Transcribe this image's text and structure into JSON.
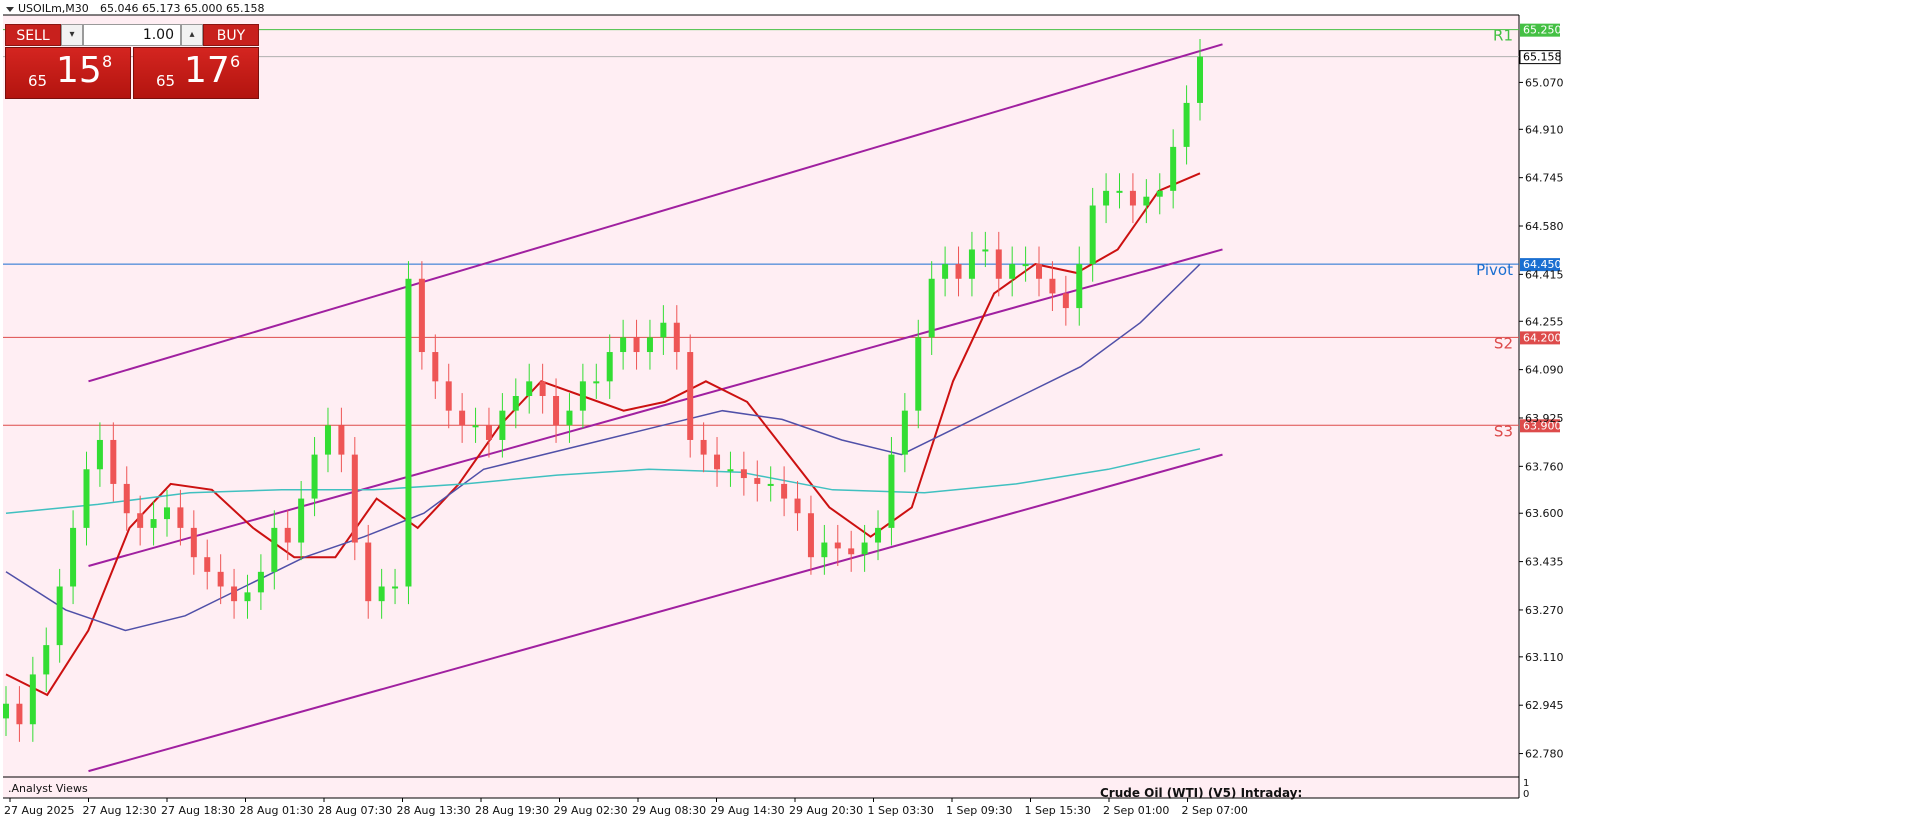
{
  "header": {
    "symbol_label": "USOILm,M30",
    "ohlc_text": "65.046 65.173 65.000 65.158",
    "menu_icon": "triangle-down-icon"
  },
  "trade_panel": {
    "sell_label": "SELL",
    "buy_label": "BUY",
    "lot_value": "1.00",
    "bid": {
      "prefix": "65",
      "big": "15",
      "sup": "8"
    },
    "ask": {
      "prefix": "65",
      "big": "17",
      "sup": "6"
    },
    "accent": "#c8201d"
  },
  "levels": [
    {
      "id": "r1",
      "name": "R1",
      "price": 65.25,
      "price_label": "65.250",
      "color": "#44c044"
    },
    {
      "id": "pivot",
      "name": "Pivot",
      "price": 64.45,
      "price_label": "64.450",
      "color": "#1a6fd1"
    },
    {
      "id": "s2",
      "name": "S2",
      "price": 64.2,
      "price_label": "64.200",
      "color": "#dd4b4b"
    },
    {
      "id": "s3",
      "name": "S3",
      "price": 63.9,
      "price_label": "63.900",
      "color": "#dd4b4b"
    }
  ],
  "current_price": {
    "price": 65.158,
    "label": "65.158"
  },
  "price_axis": {
    "min": 62.7,
    "max": 65.3,
    "ticks": [
      "65.070",
      "64.910",
      "64.745",
      "64.580",
      "64.415",
      "64.255",
      "64.090",
      "63.925",
      "63.760",
      "63.600",
      "63.435",
      "63.270",
      "63.110",
      "62.945",
      "62.780"
    ]
  },
  "time_axis": {
    "labels": [
      "27 Aug 2025",
      "27 Aug 12:30",
      "27 Aug 18:30",
      "28 Aug 01:30",
      "28 Aug 07:30",
      "28 Aug 13:30",
      "28 Aug 19:30",
      "29 Aug 02:30",
      "29 Aug 08:30",
      "29 Aug 14:30",
      "29 Aug 20:30",
      "1 Sep 03:30",
      "1 Sep 09:30",
      "1 Sep 15:30",
      "2 Sep 01:00",
      "2 Sep 07:00"
    ]
  },
  "colors": {
    "chart_bg": "#ffeef3",
    "bull": "#33dd33",
    "bear": "#ee5555",
    "channel": "#a020a0",
    "ma_fast": "#cc1111",
    "ma_mid": "#5050a8",
    "ma_slow": "#40c0c0"
  },
  "chart_data": {
    "type": "candlestick",
    "timeframe": "M30",
    "symbol": "USOILm",
    "ylim": [
      62.7,
      65.3
    ],
    "x_categories": [
      "27 Aug 2025",
      "27 Aug 12:30",
      "27 Aug 18:30",
      "28 Aug 01:30",
      "28 Aug 07:30",
      "28 Aug 13:30",
      "28 Aug 19:30",
      "29 Aug 02:30",
      "29 Aug 08:30",
      "29 Aug 14:30",
      "29 Aug 20:30",
      "1 Sep 03:30",
      "1 Sep 09:30",
      "1 Sep 15:30",
      "2 Sep 01:00",
      "2 Sep 07:00"
    ],
    "series": [
      {
        "kind": "close",
        "values": [
          62.95,
          62.88,
          63.05,
          63.15,
          63.35,
          63.55,
          63.75,
          63.85,
          63.7,
          63.6,
          63.55,
          63.58,
          63.62,
          63.55,
          63.45,
          63.4,
          63.35,
          63.3,
          63.33,
          63.4,
          63.55,
          63.5,
          63.65,
          63.8,
          63.9,
          63.8,
          63.5,
          63.3,
          63.35,
          63.35,
          64.4,
          64.15,
          64.05,
          63.95,
          63.9,
          63.9,
          63.85,
          63.95,
          64.0,
          64.05,
          64.0,
          63.9,
          63.95,
          64.05,
          64.05,
          64.15,
          64.2,
          64.15,
          64.2,
          64.25,
          64.15,
          63.85,
          63.8,
          63.75,
          63.75,
          63.72,
          63.7,
          63.7,
          63.65,
          63.6,
          63.45,
          63.5,
          63.48,
          63.46,
          63.5,
          63.55,
          63.8,
          63.95,
          64.2,
          64.4,
          64.45,
          64.4,
          64.5,
          64.5,
          64.4,
          64.45,
          64.45,
          64.4,
          64.35,
          64.3,
          64.45,
          64.65,
          64.7,
          64.7,
          64.65,
          64.68,
          64.7,
          64.85,
          65.0,
          65.158
        ]
      },
      {
        "name": "",
        "kind": "ma_fast",
        "values": [
          63.05,
          62.98,
          63.2,
          63.55,
          63.7,
          63.68,
          63.55,
          63.45,
          63.45,
          63.65,
          63.55,
          63.7,
          63.9,
          64.05,
          64.0,
          63.95,
          63.98,
          64.05,
          63.98,
          63.8,
          63.62,
          63.52,
          63.62,
          64.05,
          64.35,
          64.45,
          64.42,
          64.5,
          64.7,
          64.76
        ]
      },
      {
        "name": "",
        "kind": "ma_mid",
        "values": [
          63.4,
          63.27,
          63.2,
          63.25,
          63.35,
          63.45,
          63.52,
          63.6,
          63.75,
          63.8,
          63.85,
          63.9,
          63.95,
          63.92,
          63.85,
          63.8,
          63.9,
          64.0,
          64.1,
          64.25,
          64.45
        ]
      },
      {
        "name": "",
        "kind": "ma_slow",
        "values": [
          63.6,
          63.63,
          63.67,
          63.68,
          63.68,
          63.7,
          63.73,
          63.75,
          63.74,
          63.68,
          63.67,
          63.7,
          63.75,
          63.82
        ]
      }
    ],
    "channel": {
      "upper": [
        {
          "x": "27 Aug 12:30",
          "y": 64.05
        },
        {
          "x": "2 Sep 07:00",
          "y": 65.2
        }
      ],
      "middle": [
        {
          "x": "27 Aug 12:30",
          "y": 63.42
        },
        {
          "x": "2 Sep 07:00",
          "y": 64.5
        }
      ],
      "lower": [
        {
          "x": "27 Aug 12:30",
          "y": 62.72
        },
        {
          "x": "2 Sep 07:00",
          "y": 63.8
        }
      ]
    },
    "indicator_panel": {
      "name": ".Analyst Views",
      "scale_max": "1",
      "scale_min": "0",
      "annotation": "Crude Oil (WTI) (V5) Intraday:"
    }
  }
}
